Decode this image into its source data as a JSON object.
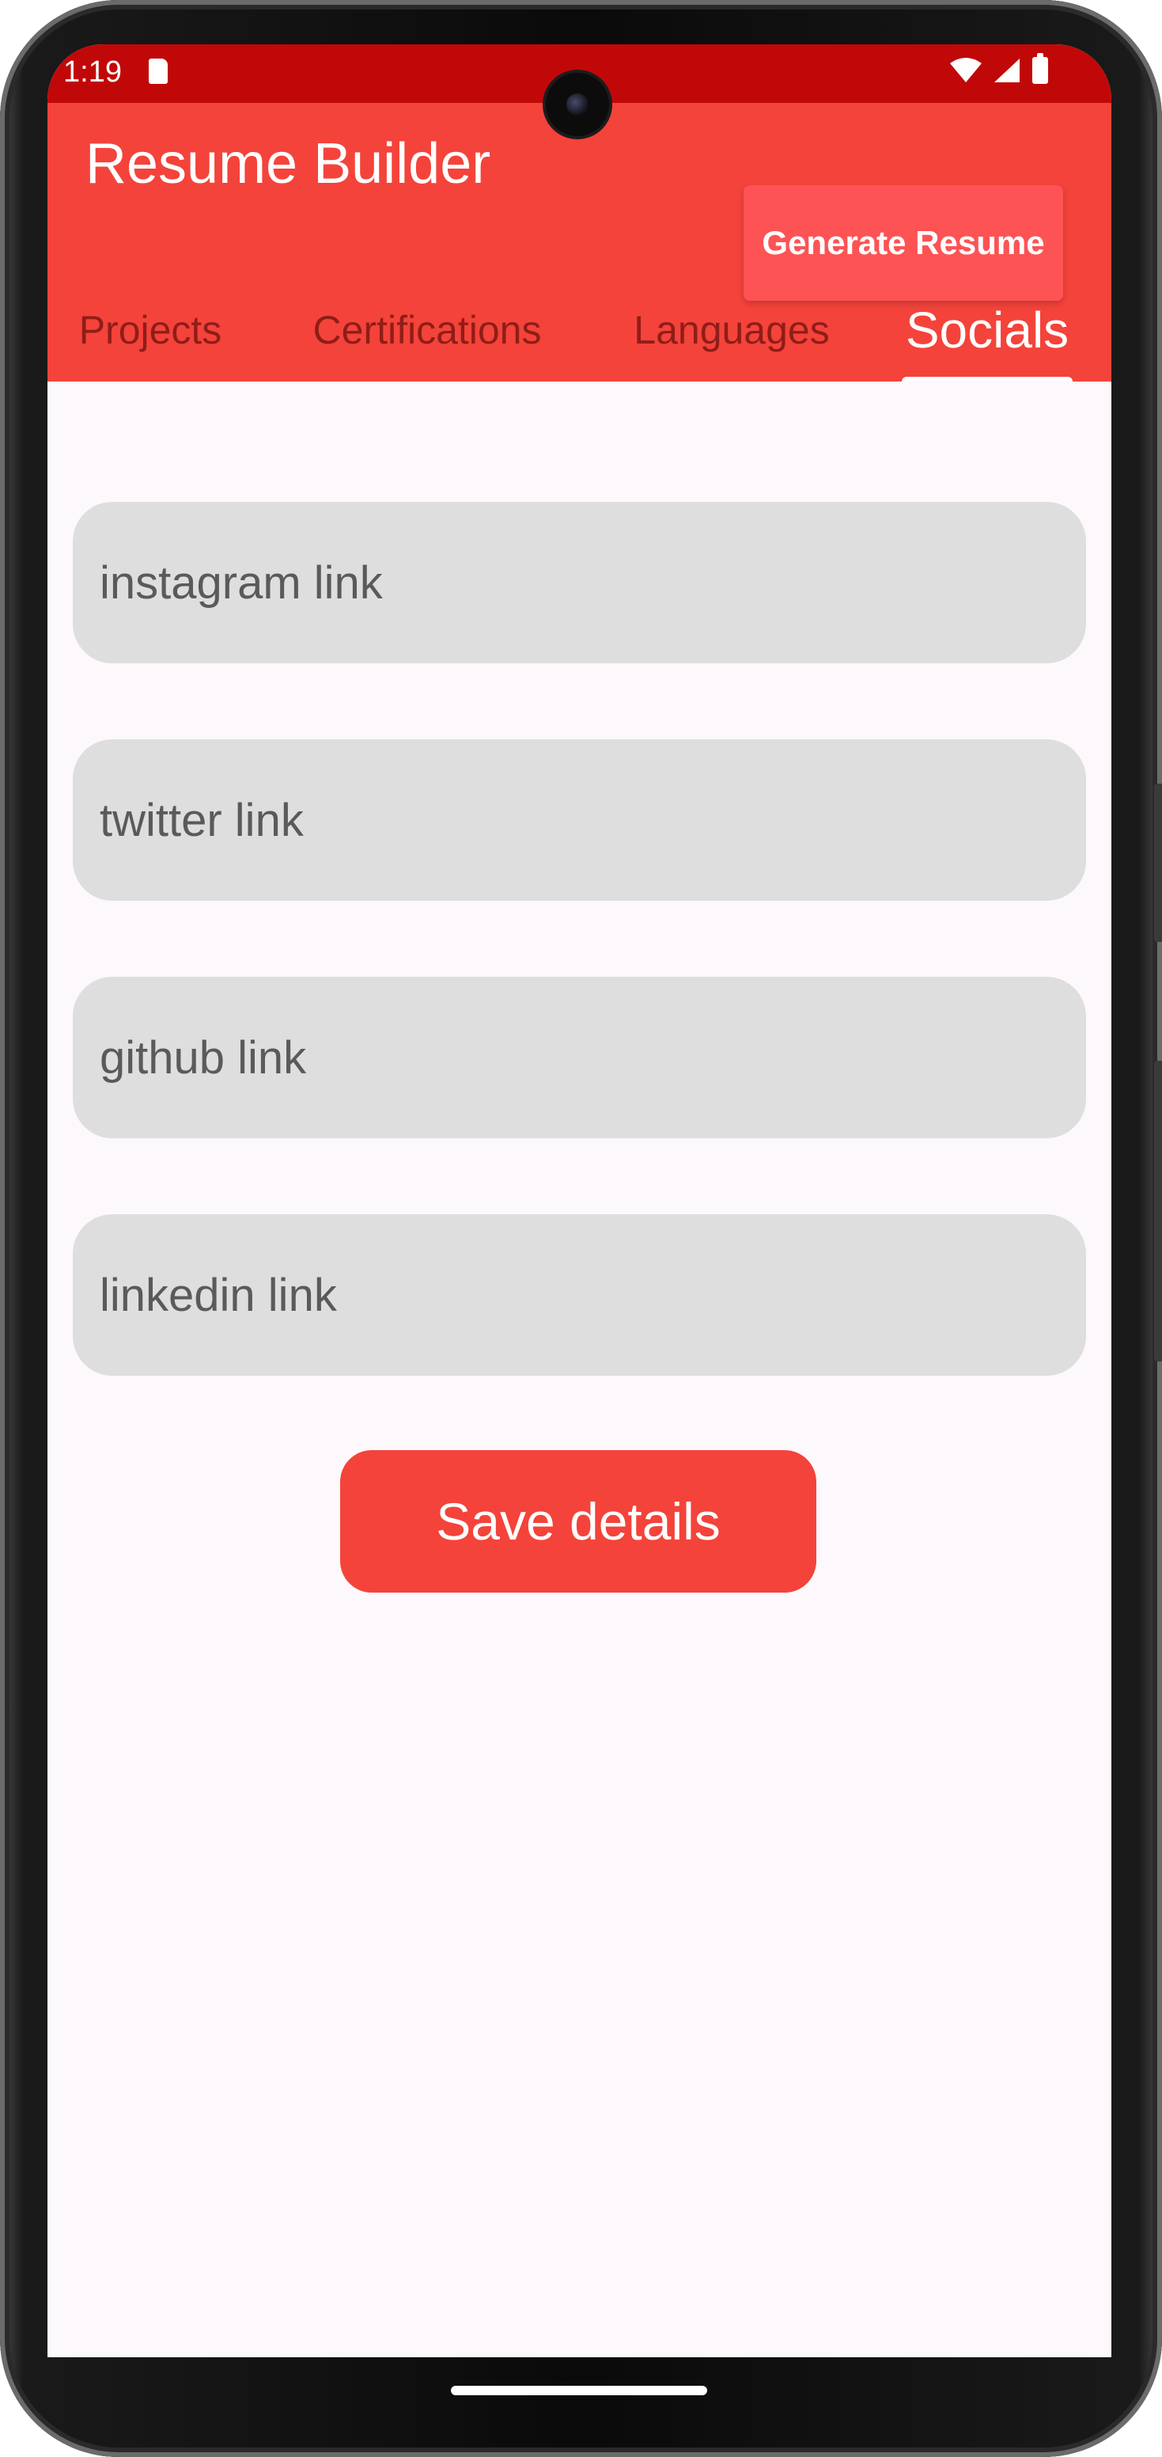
{
  "status_bar": {
    "time": "1:19",
    "icons": [
      "sd-card-icon",
      "wifi-icon",
      "signal-icon",
      "battery-icon"
    ]
  },
  "app_bar": {
    "title": "Resume Builder",
    "generate_button_label": "Generate Resume"
  },
  "tabs": [
    {
      "label": "Projects",
      "active": false
    },
    {
      "label": "Certifications",
      "active": false
    },
    {
      "label": "Languages",
      "active": false
    },
    {
      "label": "Socials",
      "active": true
    }
  ],
  "form": {
    "fields": [
      {
        "placeholder": "instagram link",
        "value": ""
      },
      {
        "placeholder": "twitter link",
        "value": ""
      },
      {
        "placeholder": "github link",
        "value": ""
      },
      {
        "placeholder": "linkedin link",
        "value": ""
      }
    ],
    "save_label": "Save details"
  },
  "colors": {
    "status_bar": "#c10808",
    "app_bar": "#f4433a",
    "generate_button": "#fd5355",
    "field_background": "#dedede",
    "screen_background": "#fdf8fc",
    "inactive_tab_text": "#8f1d18"
  }
}
